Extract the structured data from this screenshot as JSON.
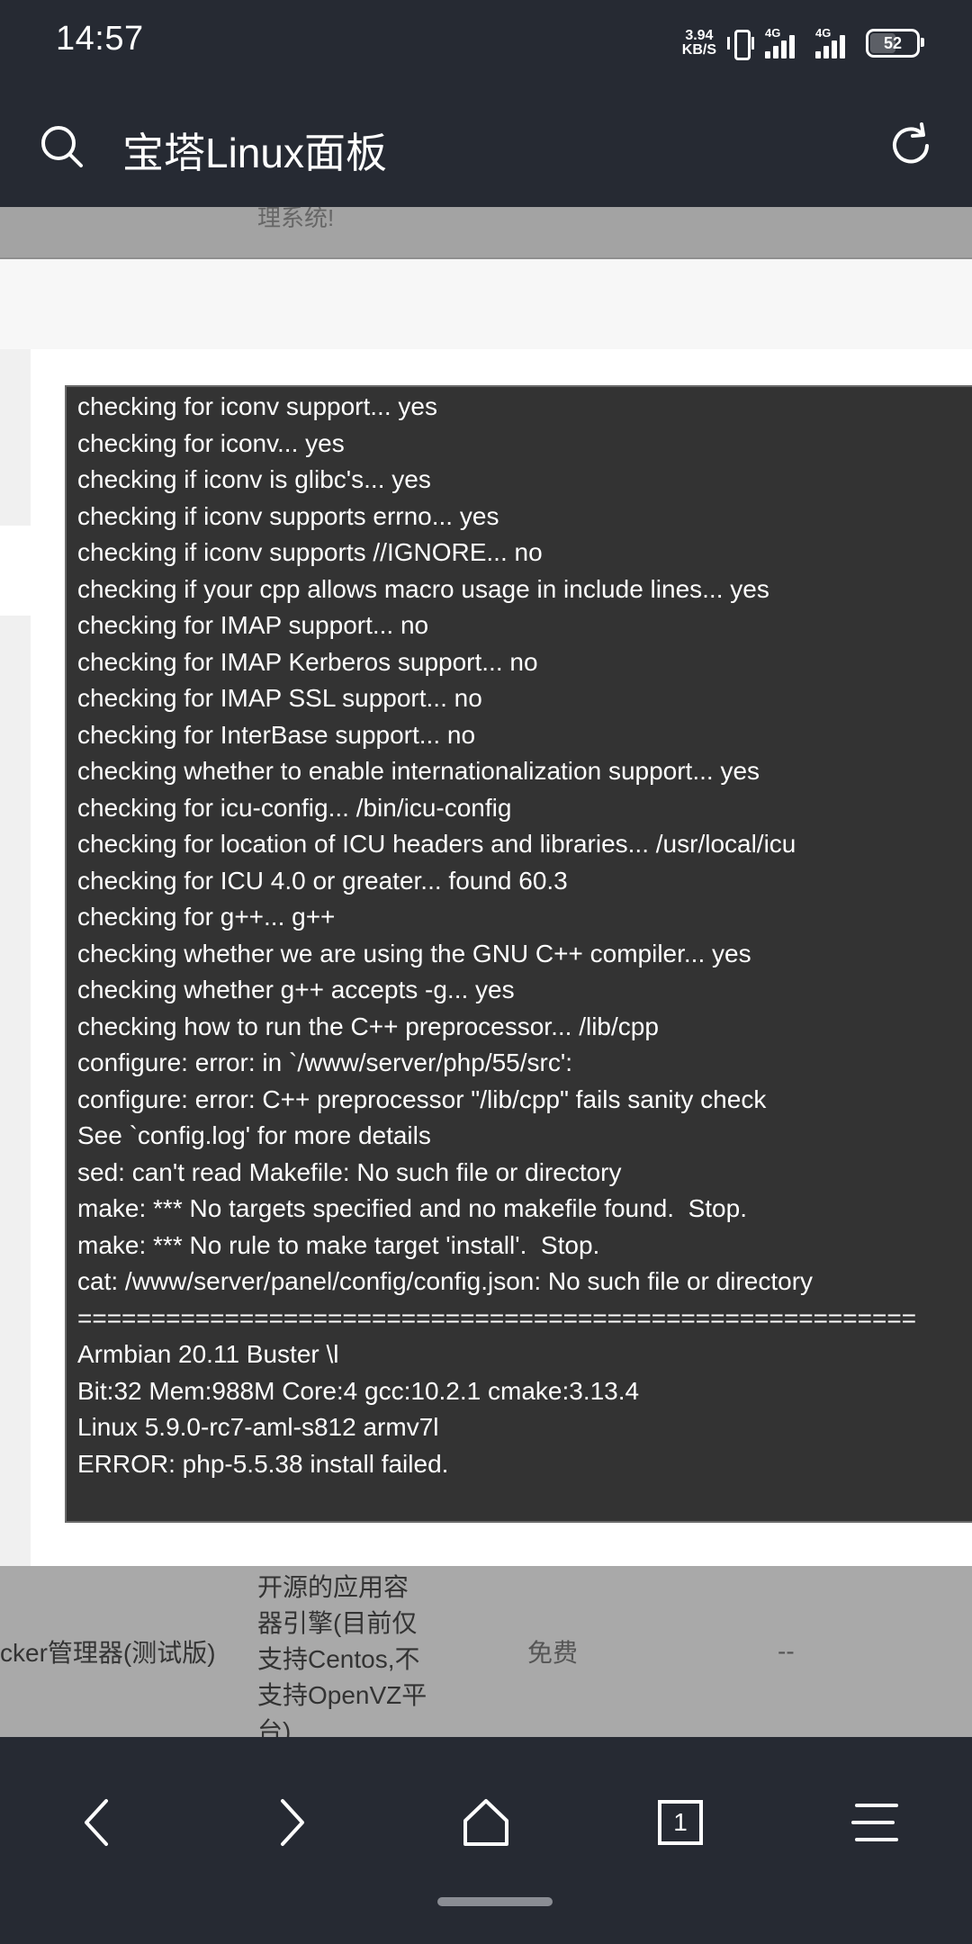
{
  "status_bar": {
    "time": "14:57",
    "net_speed_value": "3.94",
    "net_speed_unit": "KB/S",
    "signal1_label": "4G",
    "signal2_label": "4G",
    "battery": "52"
  },
  "top_bar": {
    "title": "宝塔Linux面板",
    "search_icon": "search-icon",
    "refresh_icon": "refresh-icon"
  },
  "faded_text": "理系统!",
  "terminal": {
    "lines": [
      "checking for iconv support... yes",
      "checking for iconv... yes",
      "checking if iconv is glibc's... yes",
      "checking if iconv supports errno... yes",
      "checking if iconv supports //IGNORE... no",
      "checking if your cpp allows macro usage in include lines... yes",
      "checking for IMAP support... no",
      "checking for IMAP Kerberos support... no",
      "checking for IMAP SSL support... no",
      "checking for InterBase support... no",
      "checking whether to enable internationalization support... yes",
      "checking for icu-config... /bin/icu-config",
      "checking for location of ICU headers and libraries... /usr/local/icu",
      "checking for ICU 4.0 or greater... found 60.3",
      "checking for g++... g++",
      "checking whether we are using the GNU C++ compiler... yes",
      "checking whether g++ accepts -g... yes",
      "checking how to run the C++ preprocessor... /lib/cpp",
      "configure: error: in `/www/server/php/55/src':",
      "configure: error: C++ preprocessor \"/lib/cpp\" fails sanity check",
      "See `config.log' for more details",
      "sed: can't read Makefile: No such file or directory",
      "make: *** No targets specified and no makefile found.  Stop.",
      "make: *** No rule to make target 'install'.  Stop.",
      "cat: /www/server/panel/config/config.json: No such file or directory",
      "=========================================================",
      "Armbian 20.11 Buster \\l",
      "Bit:32 Mem:988M Core:4 gcc:10.2.1 cmake:3.13.4",
      "Linux 5.9.0-rc7-aml-s812 armv7l",
      "ERROR: php-5.5.38 install failed."
    ]
  },
  "table_row": {
    "name": "cker管理器(测试版)",
    "description": [
      "开源的应用容",
      "器引擎(目前仅",
      "支持Centos,不",
      "支持OpenVZ平",
      "台)"
    ],
    "price": "免费",
    "expire": "--"
  },
  "bottom_nav": {
    "tab_count": "1",
    "icons": [
      "back-icon",
      "forward-icon",
      "home-icon",
      "tabs-icon",
      "menu-icon"
    ]
  }
}
